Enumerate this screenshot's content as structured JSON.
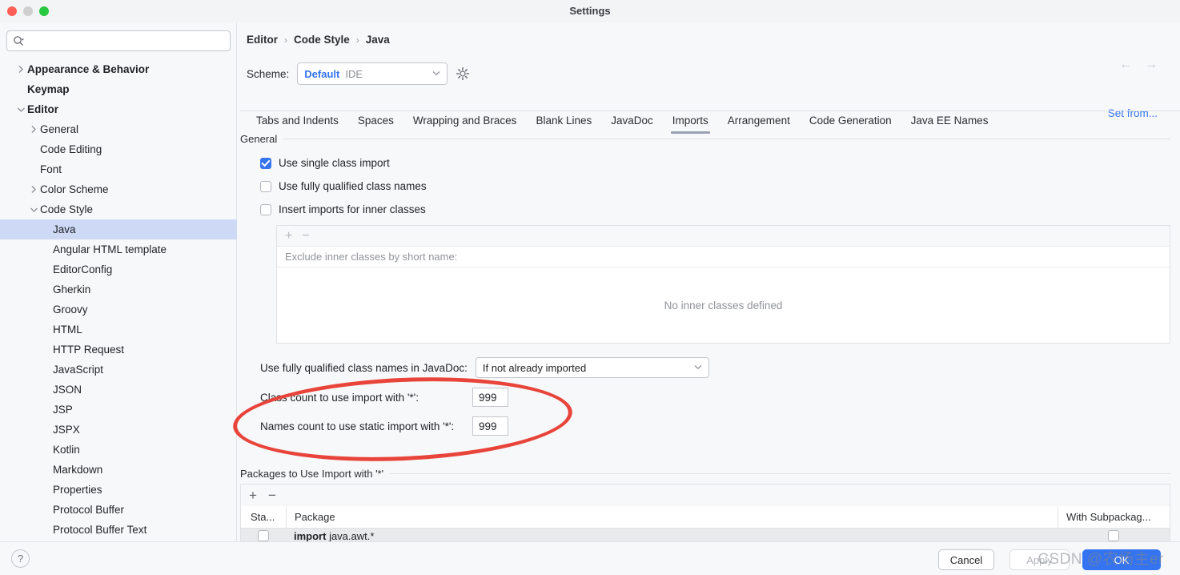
{
  "window": {
    "title": "Settings",
    "traffic_lights": [
      "close-button",
      "minimize-button",
      "maximize-button"
    ]
  },
  "sidebar": {
    "search": {
      "value": "",
      "placeholder": "",
      "icon": "search-icon"
    },
    "items": [
      {
        "label": "Appearance & Behavior",
        "indent": 0,
        "arrow": "chevron-right",
        "bold": true,
        "selected": false
      },
      {
        "label": "Keymap",
        "indent": 0,
        "arrow": "",
        "bold": true,
        "selected": false
      },
      {
        "label": "Editor",
        "indent": 0,
        "arrow": "chevron-down",
        "bold": true,
        "selected": false
      },
      {
        "label": "General",
        "indent": 1,
        "arrow": "chevron-right",
        "bold": false,
        "selected": false
      },
      {
        "label": "Code Editing",
        "indent": 1,
        "arrow": "",
        "bold": false,
        "selected": false
      },
      {
        "label": "Font",
        "indent": 1,
        "arrow": "",
        "bold": false,
        "selected": false
      },
      {
        "label": "Color Scheme",
        "indent": 1,
        "arrow": "chevron-right",
        "bold": false,
        "selected": false
      },
      {
        "label": "Code Style",
        "indent": 1,
        "arrow": "chevron-down",
        "bold": false,
        "selected": false
      },
      {
        "label": "Java",
        "indent": 2,
        "arrow": "",
        "bold": false,
        "selected": true
      },
      {
        "label": "Angular HTML template",
        "indent": 2,
        "arrow": "",
        "bold": false,
        "selected": false
      },
      {
        "label": "EditorConfig",
        "indent": 2,
        "arrow": "",
        "bold": false,
        "selected": false
      },
      {
        "label": "Gherkin",
        "indent": 2,
        "arrow": "",
        "bold": false,
        "selected": false
      },
      {
        "label": "Groovy",
        "indent": 2,
        "arrow": "",
        "bold": false,
        "selected": false
      },
      {
        "label": "HTML",
        "indent": 2,
        "arrow": "",
        "bold": false,
        "selected": false
      },
      {
        "label": "HTTP Request",
        "indent": 2,
        "arrow": "",
        "bold": false,
        "selected": false
      },
      {
        "label": "JavaScript",
        "indent": 2,
        "arrow": "",
        "bold": false,
        "selected": false
      },
      {
        "label": "JSON",
        "indent": 2,
        "arrow": "",
        "bold": false,
        "selected": false
      },
      {
        "label": "JSP",
        "indent": 2,
        "arrow": "",
        "bold": false,
        "selected": false
      },
      {
        "label": "JSPX",
        "indent": 2,
        "arrow": "",
        "bold": false,
        "selected": false
      },
      {
        "label": "Kotlin",
        "indent": 2,
        "arrow": "",
        "bold": false,
        "selected": false
      },
      {
        "label": "Markdown",
        "indent": 2,
        "arrow": "",
        "bold": false,
        "selected": false
      },
      {
        "label": "Properties",
        "indent": 2,
        "arrow": "",
        "bold": false,
        "selected": false
      },
      {
        "label": "Protocol Buffer",
        "indent": 2,
        "arrow": "",
        "bold": false,
        "selected": false
      },
      {
        "label": "Protocol Buffer Text",
        "indent": 2,
        "arrow": "",
        "bold": false,
        "selected": false
      }
    ]
  },
  "header": {
    "breadcrumb": [
      "Editor",
      "Code Style",
      "Java"
    ],
    "separator": "›",
    "nav_back": "←",
    "nav_forward": "→",
    "scheme_label": "Scheme:",
    "scheme_primary": "Default",
    "scheme_secondary": "IDE",
    "scheme_chevron": "⌄",
    "gear_icon": "gear-icon",
    "set_from_link": "Set from..."
  },
  "tabs": [
    {
      "label": "Tabs and Indents",
      "active": false
    },
    {
      "label": "Spaces",
      "active": false
    },
    {
      "label": "Wrapping and Braces",
      "active": false
    },
    {
      "label": "Blank Lines",
      "active": false
    },
    {
      "label": "JavaDoc",
      "active": false
    },
    {
      "label": "Imports",
      "active": true
    },
    {
      "label": "Arrangement",
      "active": false
    },
    {
      "label": "Code Generation",
      "active": false
    },
    {
      "label": "Java EE Names",
      "active": false
    }
  ],
  "general_section": {
    "title": "General",
    "checkboxes": [
      {
        "label": "Use single class import",
        "checked": true
      },
      {
        "label": "Use fully qualified class names",
        "checked": false
      },
      {
        "label": "Insert imports for inner classes",
        "checked": false
      }
    ],
    "inner_panel": {
      "add_icon": "plus-icon",
      "remove_icon": "minus-icon",
      "column_header": "Exclude inner classes by short name:",
      "empty_text": "No inner classes defined"
    },
    "javadoc_field": {
      "label": "Use fully qualified class names in JavaDoc:",
      "value": "If not already imported",
      "chevron": "⌄"
    },
    "class_count": {
      "label": "Class count to use import with '*':",
      "value": "999"
    },
    "names_count": {
      "label": "Names count to use static import with '*':",
      "value": "999"
    }
  },
  "packages_section": {
    "title": "Packages to Use Import with '*'",
    "add_icon": "plus-icon",
    "remove_icon": "minus-icon",
    "columns": [
      "Sta...",
      "Package",
      "With Subpackag..."
    ],
    "rows": [
      {
        "static": false,
        "package_prefix": "import",
        "package_rest": " java.awt.*",
        "with_subpackages": false
      }
    ]
  },
  "footer": {
    "help_label": "?",
    "cancel_label": "Cancel",
    "apply_label": "Apply",
    "ok_label": "OK"
  },
  "watermark": {
    "text": "CSDN @农场主er"
  },
  "annotation": {
    "shape": "red-ellipse",
    "color": "#e8443a"
  }
}
